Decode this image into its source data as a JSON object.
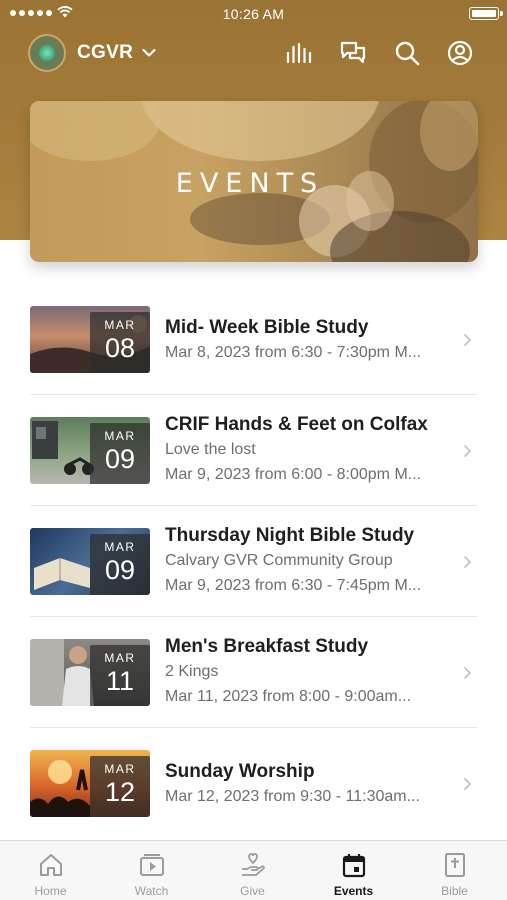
{
  "status_bar": {
    "time": "10:26 AM"
  },
  "header": {
    "org_name": "CGVR"
  },
  "hero": {
    "title": "EVENTS"
  },
  "events": [
    {
      "month": "MAR",
      "day": "08",
      "title": "Mid- Week Bible Study",
      "subtitle": "",
      "date_text": "Mar 8, 2023 from 6:30 - 7:30pm M..."
    },
    {
      "month": "MAR",
      "day": "09",
      "title": "CRIF Hands & Feet on Colfax",
      "subtitle": "Love the lost",
      "date_text": "Mar 9, 2023 from 6:00 - 8:00pm M..."
    },
    {
      "month": "MAR",
      "day": "09",
      "title": "Thursday Night Bible Study",
      "subtitle": "Calvary GVR Community Group",
      "date_text": "Mar 9, 2023 from 6:30 - 7:45pm M..."
    },
    {
      "month": "MAR",
      "day": "11",
      "title": "Men's Breakfast Study",
      "subtitle": "2 Kings",
      "date_text": "Mar 11, 2023 from 8:00 - 9:00am..."
    },
    {
      "month": "MAR",
      "day": "12",
      "title": "Sunday Worship",
      "subtitle": "",
      "date_text": "Mar 12, 2023 from 9:30 - 11:30am..."
    }
  ],
  "tabs": [
    {
      "label": "Home",
      "icon": "home-icon"
    },
    {
      "label": "Watch",
      "icon": "watch-icon"
    },
    {
      "label": "Give",
      "icon": "give-icon"
    },
    {
      "label": "Events",
      "icon": "calendar-icon",
      "active": true
    },
    {
      "label": "Bible",
      "icon": "bible-icon"
    }
  ],
  "colors": {
    "header_brown": "#a47b3a",
    "active_tab": "#1a1a1a",
    "inactive_tab": "#9b9b9b"
  }
}
